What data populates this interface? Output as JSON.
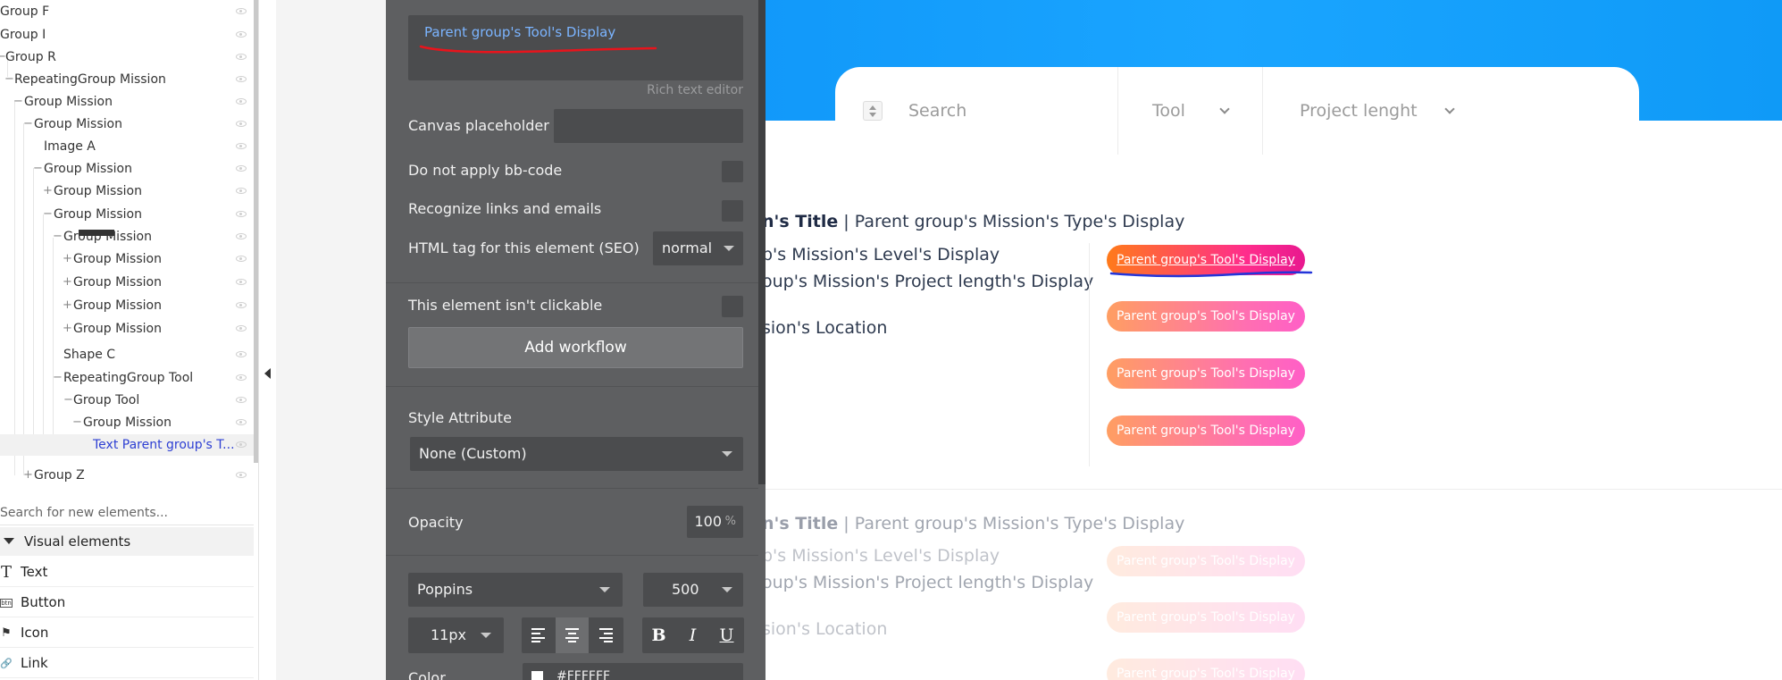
{
  "tree": {
    "rows": [
      {
        "label": "Group F",
        "expander": ""
      },
      {
        "label": "Group I",
        "expander": ""
      },
      {
        "label": "Group R",
        "expander": "−"
      },
      {
        "label": "RepeatingGroup Mission",
        "expander": "−"
      },
      {
        "label": "Group Mission",
        "expander": "−"
      },
      {
        "label": "Group Mission",
        "expander": "−"
      },
      {
        "label": "Image A",
        "expander": ""
      },
      {
        "label": "Group Mission",
        "expander": "−"
      },
      {
        "label": "Group Mission",
        "expander": "+"
      },
      {
        "label": "Group Mission",
        "expander": "−"
      },
      {
        "label": "Group Mission",
        "expander": "−"
      },
      {
        "label": "Group Mission",
        "expander": "+"
      },
      {
        "label": "Group Mission",
        "expander": "+"
      },
      {
        "label": "Group Mission",
        "expander": "+"
      },
      {
        "label": "Group Mission",
        "expander": "+"
      },
      {
        "label": "Shape C",
        "expander": ""
      },
      {
        "label": "RepeatingGroup Tool",
        "expander": "−"
      },
      {
        "label": "Group Tool",
        "expander": "−"
      },
      {
        "label": "Group Mission",
        "expander": "−"
      },
      {
        "label": "Text Parent group's T...",
        "expander": ""
      },
      {
        "label": "Group Z",
        "expander": "+"
      }
    ],
    "search_placeholder": "Search for new elements...",
    "visual_header": "Visual elements",
    "visual_items": [
      {
        "label": "Text",
        "icon": "T"
      },
      {
        "label": "Button",
        "icon": "btn"
      },
      {
        "label": "Icon",
        "icon": "⚑"
      },
      {
        "label": "Link",
        "icon": "🔗"
      }
    ]
  },
  "canvas": {
    "search_label": "Search",
    "tool_label": "Tool",
    "project_label": "Project lenght",
    "card1": {
      "title_bold": "n's Title",
      "title_rest": " | Parent group's Mission's Type's Display",
      "level": "p's Mission's Level's Display",
      "length": "oup's Mission's Project length's Display",
      "location": "sion's Location"
    },
    "card2": {
      "title_bold": "n's Title",
      "title_rest": " | Parent group's Mission's Type's Display",
      "level": "p's Mission's Level's Display",
      "length": "oup's Mission's Project length's Display",
      "location": "sion's Location"
    },
    "pills": [
      "Parent group's Tool's Display",
      "Parent group's Tool's Display",
      "Parent group's Tool's Display",
      "Parent group's Tool's Display"
    ],
    "faded_pills": [
      "Parent group's Tool's Display",
      "Parent group's Tool's Display",
      "Parent group's Tool's Display"
    ]
  },
  "panel": {
    "rte_text": "Parent group's Tool's Display",
    "rte_caption": "Rich text editor",
    "canvas_placeholder": "Canvas placeholder",
    "no_bbcode": "Do not apply bb-code",
    "recognize_links": "Recognize links and emails",
    "html_tag_label": "HTML tag for this element (SEO)",
    "html_tag_value": "normal",
    "not_clickable": "This element isn't clickable",
    "add_workflow": "Add workflow",
    "style_attribute": "Style Attribute",
    "style_value": "None (Custom)",
    "opacity_label": "Opacity",
    "opacity_value": "100",
    "opacity_unit": "%",
    "font_family": "Poppins",
    "font_weight": "500",
    "font_size": "11px",
    "bold": "B",
    "italic": "I",
    "underline": "U",
    "color_label": "Color",
    "color_hex": "#FFFFFF"
  },
  "colors": {
    "hero_blue": "#0a8ff5",
    "panel_bg": "#5e5f61",
    "selected_tree_text": "#2d3fd3",
    "link_blue": "#7bb4ff",
    "pill_start": "#ff9e62",
    "pill_end": "#ff5fc7",
    "annotation_red": "#e8141c",
    "annotation_blue": "#2335d9"
  }
}
